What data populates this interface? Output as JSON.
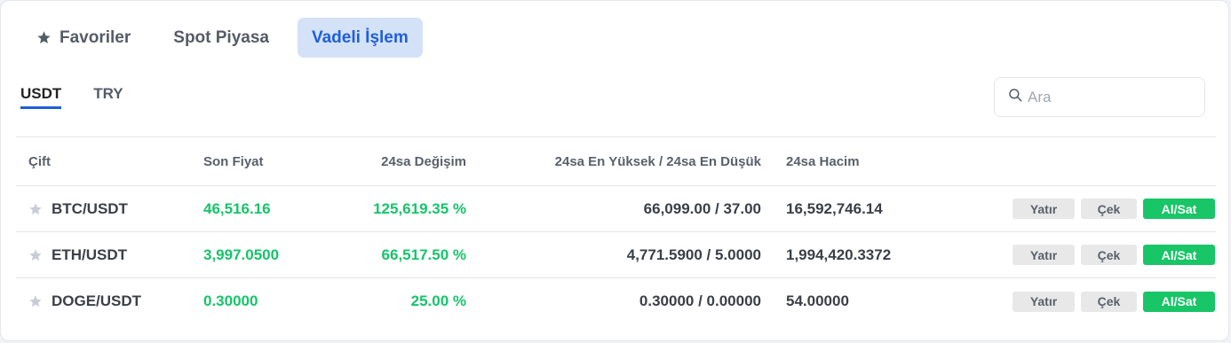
{
  "tabs": [
    {
      "label": "Favoriler",
      "icon": "star-icon"
    },
    {
      "label": "Spot Piyasa"
    },
    {
      "label": "Vadeli İşlem",
      "active": true
    }
  ],
  "currency_tabs": [
    {
      "label": "USDT",
      "active": true
    },
    {
      "label": "TRY"
    }
  ],
  "search": {
    "placeholder": "Ara",
    "value": ""
  },
  "table": {
    "headers": {
      "pair": "Çift",
      "last_price": "Son Fiyat",
      "change": "24sa Değişim",
      "high_low": "24sa En Yüksek / 24sa En Düşük",
      "volume": "24sa Hacim"
    },
    "rows": [
      {
        "pair": "BTC/USDT",
        "last_price": "46,516.16",
        "change": "125,619.35 %",
        "high_low": "66,099.00 / 37.00",
        "volume": "16,592,746.14"
      },
      {
        "pair": "ETH/USDT",
        "last_price": "3,997.0500",
        "change": "66,517.50 %",
        "high_low": "4,771.5900 / 5.0000",
        "volume": "1,994,420.3372"
      },
      {
        "pair": "DOGE/USDT",
        "last_price": "0.30000",
        "change": "25.00 %",
        "high_low": "0.30000 / 0.00000",
        "volume": "54.00000"
      }
    ],
    "actions": {
      "deposit": "Yatır",
      "withdraw": "Çek",
      "trade": "Al/Sat"
    }
  },
  "colors": {
    "accent": "#1f5fd8",
    "active_tab_bg": "#d4e2f8",
    "positive": "#16c46a",
    "trade_button": "#18c567",
    "secondary_button": "#e8e8e8"
  }
}
